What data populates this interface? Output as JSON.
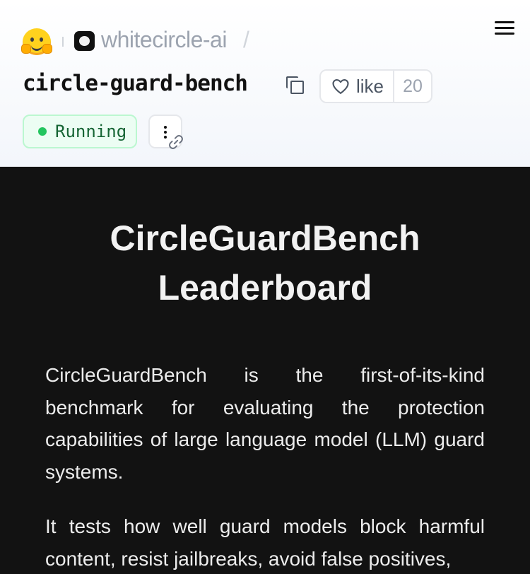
{
  "header": {
    "org_name": "whitecircle-ai",
    "separator": "/",
    "repo_name": "circle-guard-bench",
    "like_label": "like",
    "like_count": "20",
    "status": "Running",
    "icons": [
      "hugging-face-logo",
      "org-avatar",
      "menu-icon",
      "copy-icon",
      "heart-icon",
      "more-icon",
      "link-icon"
    ]
  },
  "main": {
    "title_line1": "CircleGuardBench",
    "title_line2": "Leaderboard",
    "paragraph1": "CircleGuardBench is the first-of-its-kind benchmark for evaluating the protection capabilities of large language model (LLM) guard systems.",
    "paragraph2": "It tests how well guard models block harmful content, resist jailbreaks, avoid false positives,"
  },
  "colors": {
    "main_background": "#121212",
    "status_green": "#22c55e",
    "like_border": "#e5e7eb"
  }
}
